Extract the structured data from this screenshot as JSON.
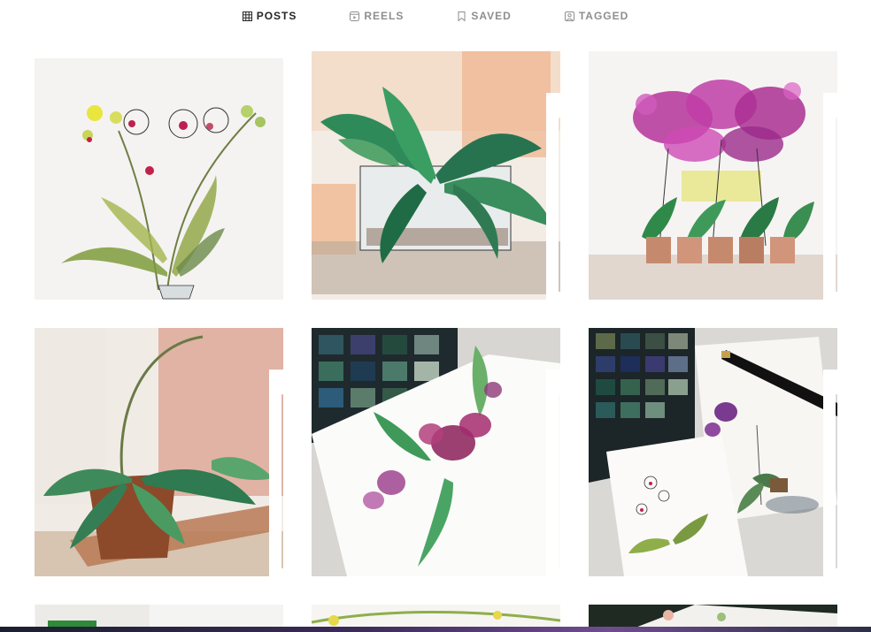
{
  "tabs": [
    {
      "label": "POSTS",
      "icon": "grid-icon",
      "active": true
    },
    {
      "label": "REELS",
      "icon": "reels-icon",
      "active": false
    },
    {
      "label": "SAVED",
      "icon": "bookmark-icon",
      "active": false
    },
    {
      "label": "TAGGED",
      "icon": "tagged-icon",
      "active": false
    }
  ],
  "posts": [
    {
      "subject": "white orchid with green leaves, pen and watercolor",
      "multi": false
    },
    {
      "subject": "orchid leaves in white pot, watercolor",
      "multi": true
    },
    {
      "subject": "magenta orchids in terracotta pots",
      "multi": true
    },
    {
      "subject": "orchid plant in clay pot against pink wall",
      "multi": true
    },
    {
      "subject": "purple orchid sketch beside watercolor palette",
      "multi": true
    },
    {
      "subject": "orchid sketches with palette and fountain pen",
      "multi": true
    },
    {
      "subject": "partial post",
      "multi": false
    },
    {
      "subject": "partial post",
      "multi": false
    },
    {
      "subject": "partial post",
      "multi": true
    }
  ],
  "colors": {
    "active_tab": "#262626",
    "inactive_tab": "#8e8e8e",
    "background": "#ffffff"
  }
}
